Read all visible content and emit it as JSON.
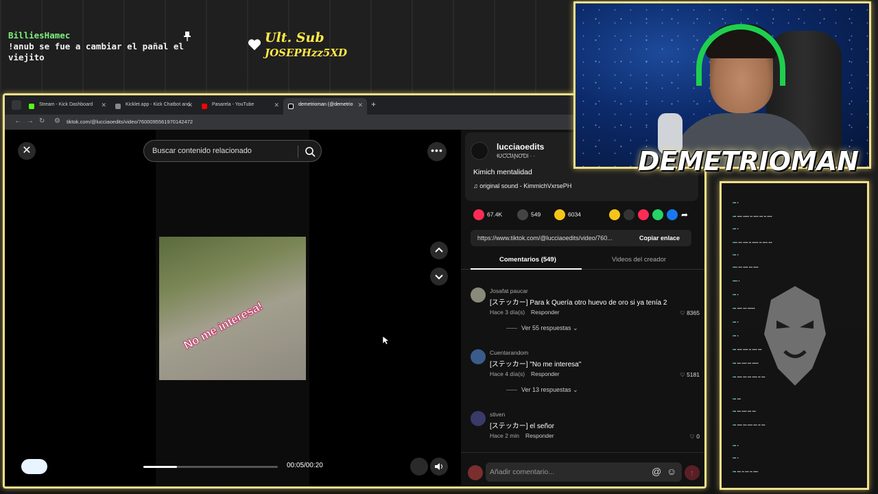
{
  "overlay": {
    "chat_user": "BilliesHamec",
    "chat_text": "!anub se fue a cambiar el pañal el viejito",
    "sub_title": "Ult. Sub",
    "sub_name": "JOSEPHzz5XD",
    "streamer_name": "DEMETRIOMAN",
    "colors": {
      "frame": "#f4e08a",
      "sub": "#ffe94a",
      "chat_user": "#7ef07e"
    }
  },
  "browser": {
    "tabs": [
      {
        "label": "Stream - Kick Dashboard",
        "icon": "kick-icon"
      },
      {
        "label": "Kicklet.app - Kick Chatbot and",
        "icon": "kicklet-icon"
      },
      {
        "label": "Pasarela - YouTube",
        "icon": "youtube-icon"
      },
      {
        "label": "demetrioman (@demetrio",
        "icon": "tiktok-icon"
      }
    ],
    "new_tab": "+",
    "url": "tiktok.com/@lucciaoedits/video/7600095561970142472"
  },
  "video": {
    "search_placeholder": "Buscar contenido relacionado",
    "thumb_caption": "No me interesa!",
    "progress": 0.25,
    "time": "00:05/00:20"
  },
  "post": {
    "author": "lucciaoedits",
    "author_sub": "ɬƲƇƇƖƛƝƠƊƖ · ·",
    "description": "Kimich mentalidad",
    "sound": "original sound - KimmichVxrsePH",
    "likes": "67.4K",
    "comments": "549",
    "saves": "6034",
    "share_url": "https://www.tiktok.com/@lucciaoedits/video/760...",
    "copy_label": "Copiar enlace",
    "tab_comments": "Comentarios (549)",
    "tab_videos": "Videos del creador"
  },
  "comments": [
    {
      "user": "Josafat paucar",
      "text": "[ステッカー] Para k Quería otro huevo de oro si ya tenía 2",
      "meta": "Hace 3 día(s)",
      "reply": "Responder",
      "likes": "8365",
      "more": "Ver 55 respuestas"
    },
    {
      "user": "Cuentarandom",
      "text": "[ステッカー] \"No me interesa\"",
      "meta": "Hace 4 día(s)",
      "reply": "Responder",
      "likes": "5181",
      "more": "Ver 13 respuestas"
    },
    {
      "user": "stiven",
      "text": "[ステッカー] el señor",
      "meta": "Hace 2 min",
      "reply": "Responder",
      "likes": "0",
      "more": ""
    }
  ],
  "comment_box": {
    "placeholder": "Añadir comentario..."
  }
}
